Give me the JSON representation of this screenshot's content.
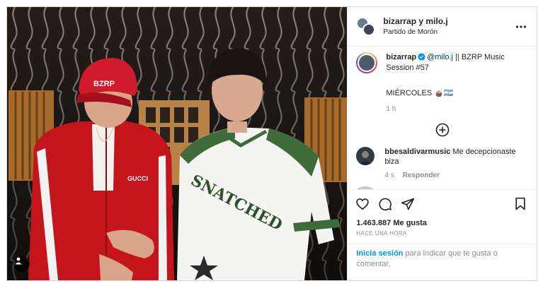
{
  "post": {
    "header": {
      "users": "bizarrap y milo.j",
      "location": "Partido de Morón",
      "more_icon": "more-horizontal-icon"
    },
    "caption": {
      "username": "bizarrap",
      "verified": true,
      "mention": "@milo.j",
      "text": " || BZRP Music Session #57",
      "extra": "MIÉRCOLES 🧉🇦🇷",
      "time": "1 h"
    },
    "load_more_icon": "plus-circle-icon",
    "comments": [
      {
        "username": "bbesaldivarmusic",
        "text": "Me decepcionaste biza",
        "time": "4 s",
        "reply_label": "Responder"
      }
    ],
    "likes": "1.463.887 Me gusta",
    "age": "HACE UNA HORA",
    "login": {
      "link": "Inicia sesión",
      "text": " para indicar que te gusta o comentar."
    },
    "photo": {
      "cap_text": "BZRP",
      "jacket_logo": "GUCCI",
      "jersey_text": "SNATCHED"
    }
  },
  "colors": {
    "link": "#0095f6",
    "mention": "#00376b",
    "verified": "#0095f6",
    "muted": "#8e8e8e",
    "jacket_red": "#c4141c",
    "jersey_green": "#3f6a3a"
  }
}
